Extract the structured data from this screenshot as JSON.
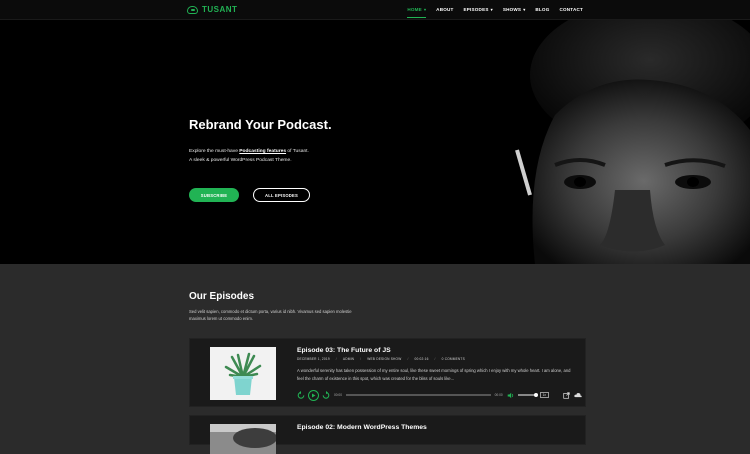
{
  "brand": {
    "name": "TUSANT"
  },
  "nav": {
    "items": [
      {
        "label": "HOME",
        "active": true,
        "dropdown": true
      },
      {
        "label": "ABOUT",
        "active": false,
        "dropdown": false
      },
      {
        "label": "EPISODES",
        "active": false,
        "dropdown": true
      },
      {
        "label": "SHOWS",
        "active": false,
        "dropdown": true
      },
      {
        "label": "BLOG",
        "active": false,
        "dropdown": false
      },
      {
        "label": "CONTACT",
        "active": false,
        "dropdown": false
      }
    ]
  },
  "hero": {
    "title": "Rebrand Your Podcast.",
    "desc_pre": "Explore the must-have ",
    "desc_link": "Podcasting features",
    "desc_post": " of Tusant.",
    "desc_line2": "A sleek & powerful WordPress Podcast Theme.",
    "subscribe": "SUBSCRIBE",
    "all_episodes": "ALL EPISODES"
  },
  "episodes_section": {
    "title": "Our Episodes",
    "desc": "Sed velit sapien, commodo et dictum porta, varius id nibh. Vivamus sed sapien molestie maximus lorem ut commodo enim."
  },
  "episodes": [
    {
      "title": "Episode 03: The Future of JS",
      "meta": [
        "DECEMBER 1, 2019",
        "ADMIN",
        "WEB DESIGN SHOW",
        "00:02:16",
        "0 COMMENTS"
      ],
      "desc": "A wonderful serenity has taken possession of my entire soul, like these sweet mornings of spring which I enjoy with my whole heart. I am alone, and feel the charm of existence in this spot, which was created for the bliss of souls like...",
      "time_start": "00:00",
      "time_end": "00:00",
      "speed": "1x"
    },
    {
      "title": "Episode 02: Modern WordPress Themes"
    }
  ],
  "colors": {
    "accent": "#21b354",
    "bg": "#2b2b2b",
    "hero_bg": "#000000",
    "card": "#1a1a1a"
  }
}
